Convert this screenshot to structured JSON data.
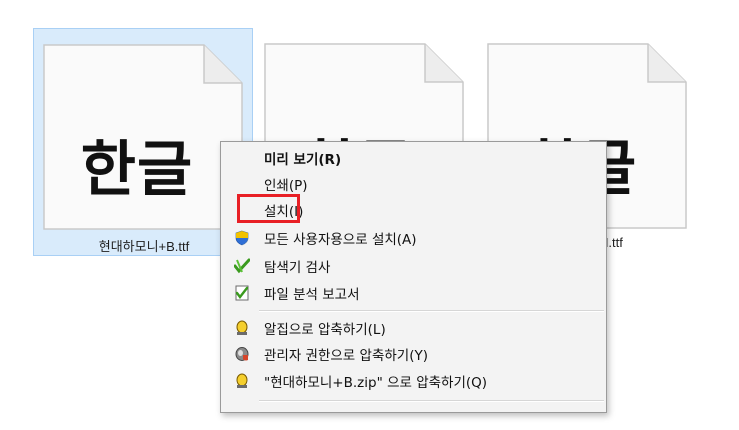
{
  "files": [
    {
      "glyph": "한글",
      "name": "현대하모니+B.ttf",
      "selected": true
    },
    {
      "glyph": "한글",
      "name": "",
      "selected": false
    },
    {
      "glyph": "한글",
      "name": "+M.ttf",
      "selected": false
    }
  ],
  "menu": {
    "preview": "미리 보기(R)",
    "print": "인쇄(P)",
    "install": "설치(I)",
    "install_all_users": "모든 사용자용으로 설치(A)",
    "explorer_scan": "탐색기 검사",
    "file_report": "파일 분석 보고서",
    "alzip_compress": "알집으로 압축하기(L)",
    "admin_compress": "관리자 권한으로 압축하기(Y)",
    "zip_named": "\"현대하모니+B.zip\" 으로 압축하기(Q)"
  },
  "colors": {
    "selection_bg": "#d9ebfb",
    "selection_border": "#a9d0f5",
    "highlight_red": "#e81f25",
    "menu_bg": "#f3f3f3"
  },
  "icons": {
    "install_all_users": "uac-shield-icon",
    "explorer_scan": "v3-scan-icon",
    "file_report": "v3-report-icon",
    "alzip_compress": "alzip-icon",
    "admin_compress": "alzip-admin-icon",
    "zip_named": "alzip-icon"
  }
}
